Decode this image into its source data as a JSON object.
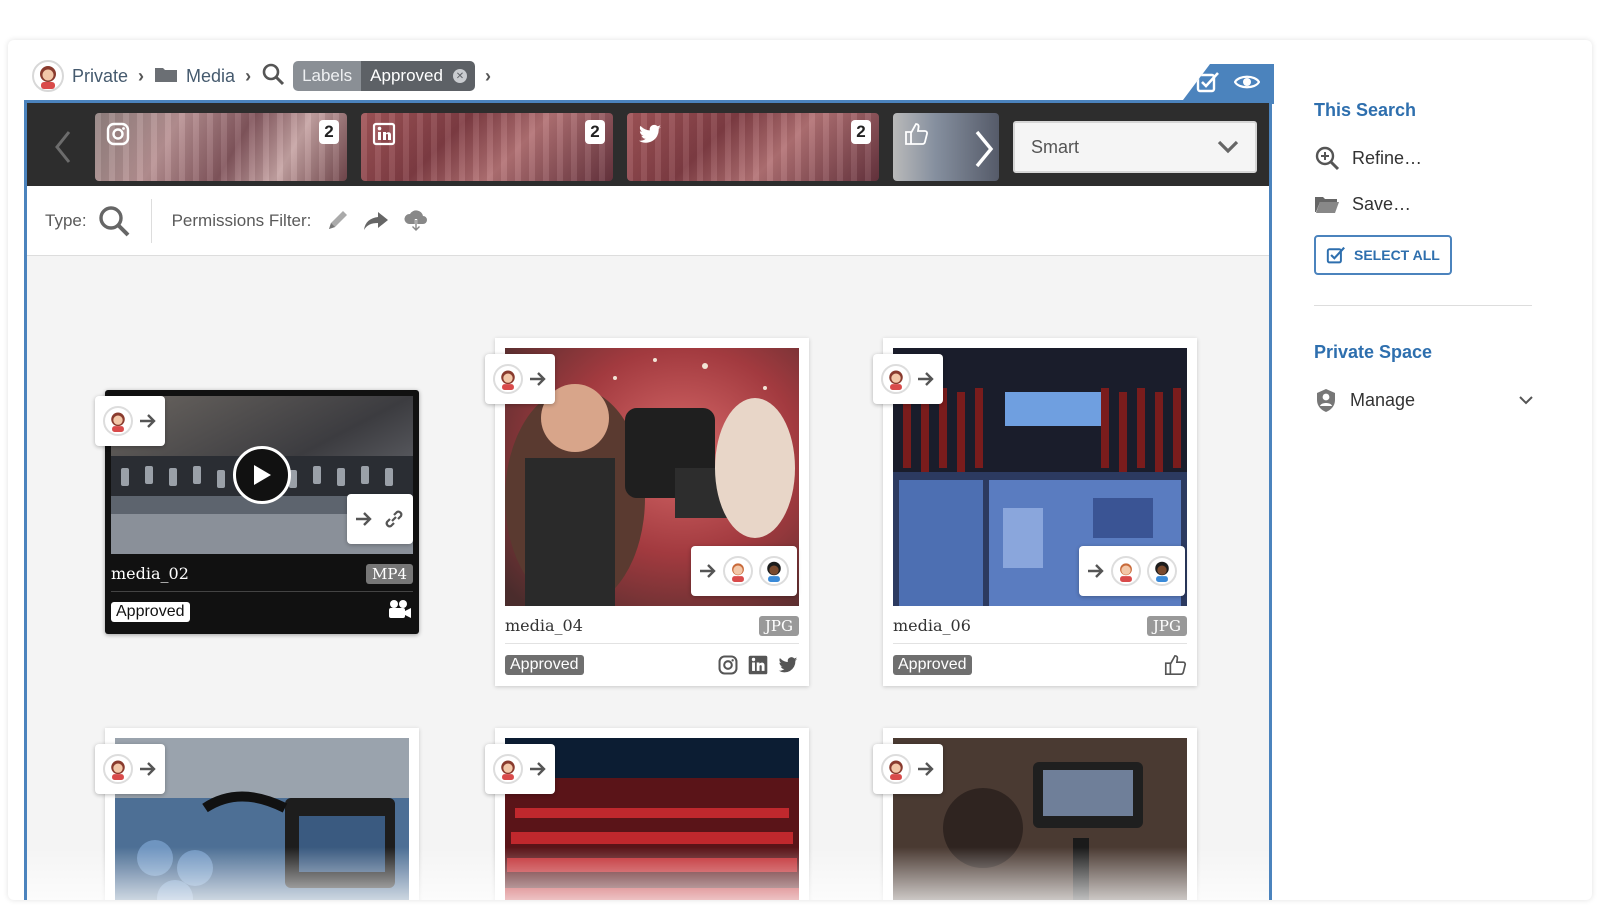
{
  "breadcrumb": {
    "private_label": "Private",
    "media_label": "Media",
    "labels_label": "Labels",
    "labels_value": "Approved"
  },
  "channels": [
    {
      "icon": "instagram-icon",
      "count": "2"
    },
    {
      "icon": "linkedin-icon",
      "count": "2"
    },
    {
      "icon": "twitter-icon",
      "count": "2"
    },
    {
      "icon": "thumbs-up-icon",
      "count": ""
    }
  ],
  "sort_select": {
    "value": "Smart"
  },
  "filters": {
    "type_label": "Type:",
    "permissions_label": "Permissions Filter:"
  },
  "cards": [
    {
      "name": "media_02",
      "type": "MP4",
      "status": "Approved"
    },
    {
      "name": "media_04",
      "type": "JPG",
      "status": "Approved"
    },
    {
      "name": "media_06",
      "type": "JPG",
      "status": "Approved"
    }
  ],
  "sidebar": {
    "this_search_title": "This Search",
    "refine_label": "Refine…",
    "save_label": "Save…",
    "select_all_label": "SELECT ALL",
    "private_space_title": "Private Space",
    "manage_label": "Manage"
  },
  "colors": {
    "accent": "#4b83bd",
    "topbar": "#2d2d2d",
    "link": "#2e6fae"
  }
}
